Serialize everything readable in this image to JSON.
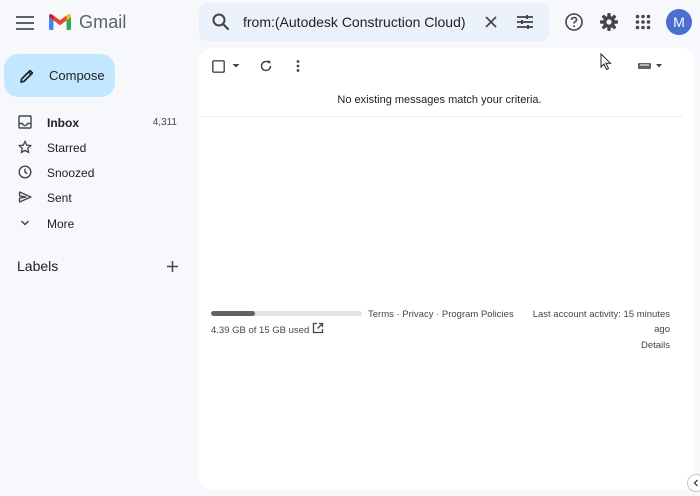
{
  "app": {
    "name": "Gmail",
    "avatar_initial": "M"
  },
  "search": {
    "value": "from:(Autodesk Construction Cloud)"
  },
  "icons": {
    "menu": "hamburger-menu-icon",
    "logo": "gmail-m-logo",
    "search": "search-icon",
    "clear": "close-icon",
    "tune": "tune-filter-icon",
    "help": "help-icon",
    "settings": "gear-icon",
    "apps": "apps-grid-icon",
    "compose": "pencil-icon"
  },
  "sidebar": {
    "compose_label": "Compose",
    "items": [
      {
        "label": "Inbox",
        "count": "4,311",
        "icon": "inbox-icon"
      },
      {
        "label": "Starred",
        "count": "",
        "icon": "star-icon"
      },
      {
        "label": "Snoozed",
        "count": "",
        "icon": "clock-icon"
      },
      {
        "label": "Sent",
        "count": "",
        "icon": "send-icon"
      },
      {
        "label": "More",
        "count": "",
        "icon": "chevron-down-icon"
      }
    ],
    "labels_heading": "Labels"
  },
  "main": {
    "empty_message": "No existing messages match your criteria.",
    "storage": {
      "text": "4.39 GB of 15 GB used",
      "used_fraction": 0.29
    },
    "footer_links": "Terms · Privacy · Program Policies",
    "activity_line1": "Last account activity: 15 minutes",
    "activity_line2": "ago",
    "details": "Details"
  },
  "colors": {
    "background": "#f6f8fc",
    "search_bg": "#eaf1fb",
    "compose_bg": "#c2e7ff",
    "avatar_bg": "#4a6fd1",
    "panel_bg": "#ffffff"
  }
}
